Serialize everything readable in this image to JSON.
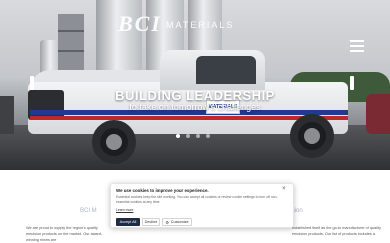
{
  "header": {
    "logo_mark": "BCI",
    "logo_text": "MATERIALS",
    "menu_icon": "hamburger-icon"
  },
  "hero": {
    "title": "BUILDING LEADERSHIP",
    "subtitle": "to take on tomorrow's challenges",
    "truck_door_text": "MATERIALS",
    "slides_total": 4,
    "active_slide": 1,
    "prev_icon": "chevron-left-icon",
    "next_icon": "chevron-right-icon"
  },
  "content": {
    "left_heading_fragment": "BCI M",
    "right_heading_fragment": "region",
    "left_paragraph": "We are proud to supply the region's quality emulsion products on the market. Our award-winning mixes are",
    "right_paragraph": "established itself as the go-to manufacturer of quality emulsion products. Our list of products includes a"
  },
  "cookie_banner": {
    "icon": "cookie-icon",
    "title": "We use cookies to improve your experience.",
    "text": "Essential cookies keep the site working. You can accept all cookies or review cookie settings to turn off non-essential cookies at any time.",
    "link": "Learn more",
    "close_icon": "close-icon",
    "close_glyph": "×",
    "accept_label": "Accept All",
    "decline_label": "Decline",
    "customize_label": "Customize"
  },
  "colors": {
    "accent_dark": "#1f2a44",
    "stripe_blue": "#1f3b8f",
    "stripe_red": "#c0272d"
  }
}
